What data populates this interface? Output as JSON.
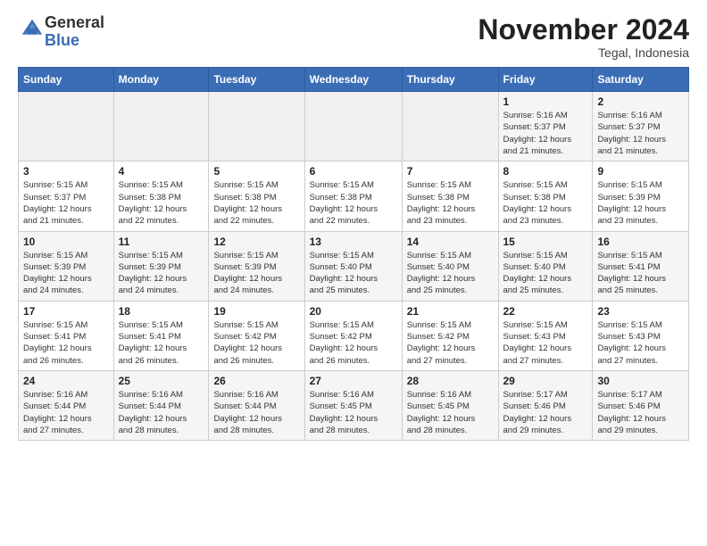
{
  "header": {
    "logo_general": "General",
    "logo_blue": "Blue",
    "month_year": "November 2024",
    "location": "Tegal, Indonesia"
  },
  "weekdays": [
    "Sunday",
    "Monday",
    "Tuesday",
    "Wednesday",
    "Thursday",
    "Friday",
    "Saturday"
  ],
  "weeks": [
    [
      {
        "day": "",
        "info": ""
      },
      {
        "day": "",
        "info": ""
      },
      {
        "day": "",
        "info": ""
      },
      {
        "day": "",
        "info": ""
      },
      {
        "day": "",
        "info": ""
      },
      {
        "day": "1",
        "info": "Sunrise: 5:16 AM\nSunset: 5:37 PM\nDaylight: 12 hours\nand 21 minutes."
      },
      {
        "day": "2",
        "info": "Sunrise: 5:16 AM\nSunset: 5:37 PM\nDaylight: 12 hours\nand 21 minutes."
      }
    ],
    [
      {
        "day": "3",
        "info": "Sunrise: 5:15 AM\nSunset: 5:37 PM\nDaylight: 12 hours\nand 21 minutes."
      },
      {
        "day": "4",
        "info": "Sunrise: 5:15 AM\nSunset: 5:38 PM\nDaylight: 12 hours\nand 22 minutes."
      },
      {
        "day": "5",
        "info": "Sunrise: 5:15 AM\nSunset: 5:38 PM\nDaylight: 12 hours\nand 22 minutes."
      },
      {
        "day": "6",
        "info": "Sunrise: 5:15 AM\nSunset: 5:38 PM\nDaylight: 12 hours\nand 22 minutes."
      },
      {
        "day": "7",
        "info": "Sunrise: 5:15 AM\nSunset: 5:38 PM\nDaylight: 12 hours\nand 23 minutes."
      },
      {
        "day": "8",
        "info": "Sunrise: 5:15 AM\nSunset: 5:38 PM\nDaylight: 12 hours\nand 23 minutes."
      },
      {
        "day": "9",
        "info": "Sunrise: 5:15 AM\nSunset: 5:39 PM\nDaylight: 12 hours\nand 23 minutes."
      }
    ],
    [
      {
        "day": "10",
        "info": "Sunrise: 5:15 AM\nSunset: 5:39 PM\nDaylight: 12 hours\nand 24 minutes."
      },
      {
        "day": "11",
        "info": "Sunrise: 5:15 AM\nSunset: 5:39 PM\nDaylight: 12 hours\nand 24 minutes."
      },
      {
        "day": "12",
        "info": "Sunrise: 5:15 AM\nSunset: 5:39 PM\nDaylight: 12 hours\nand 24 minutes."
      },
      {
        "day": "13",
        "info": "Sunrise: 5:15 AM\nSunset: 5:40 PM\nDaylight: 12 hours\nand 25 minutes."
      },
      {
        "day": "14",
        "info": "Sunrise: 5:15 AM\nSunset: 5:40 PM\nDaylight: 12 hours\nand 25 minutes."
      },
      {
        "day": "15",
        "info": "Sunrise: 5:15 AM\nSunset: 5:40 PM\nDaylight: 12 hours\nand 25 minutes."
      },
      {
        "day": "16",
        "info": "Sunrise: 5:15 AM\nSunset: 5:41 PM\nDaylight: 12 hours\nand 25 minutes."
      }
    ],
    [
      {
        "day": "17",
        "info": "Sunrise: 5:15 AM\nSunset: 5:41 PM\nDaylight: 12 hours\nand 26 minutes."
      },
      {
        "day": "18",
        "info": "Sunrise: 5:15 AM\nSunset: 5:41 PM\nDaylight: 12 hours\nand 26 minutes."
      },
      {
        "day": "19",
        "info": "Sunrise: 5:15 AM\nSunset: 5:42 PM\nDaylight: 12 hours\nand 26 minutes."
      },
      {
        "day": "20",
        "info": "Sunrise: 5:15 AM\nSunset: 5:42 PM\nDaylight: 12 hours\nand 26 minutes."
      },
      {
        "day": "21",
        "info": "Sunrise: 5:15 AM\nSunset: 5:42 PM\nDaylight: 12 hours\nand 27 minutes."
      },
      {
        "day": "22",
        "info": "Sunrise: 5:15 AM\nSunset: 5:43 PM\nDaylight: 12 hours\nand 27 minutes."
      },
      {
        "day": "23",
        "info": "Sunrise: 5:15 AM\nSunset: 5:43 PM\nDaylight: 12 hours\nand 27 minutes."
      }
    ],
    [
      {
        "day": "24",
        "info": "Sunrise: 5:16 AM\nSunset: 5:44 PM\nDaylight: 12 hours\nand 27 minutes."
      },
      {
        "day": "25",
        "info": "Sunrise: 5:16 AM\nSunset: 5:44 PM\nDaylight: 12 hours\nand 28 minutes."
      },
      {
        "day": "26",
        "info": "Sunrise: 5:16 AM\nSunset: 5:44 PM\nDaylight: 12 hours\nand 28 minutes."
      },
      {
        "day": "27",
        "info": "Sunrise: 5:16 AM\nSunset: 5:45 PM\nDaylight: 12 hours\nand 28 minutes."
      },
      {
        "day": "28",
        "info": "Sunrise: 5:16 AM\nSunset: 5:45 PM\nDaylight: 12 hours\nand 28 minutes."
      },
      {
        "day": "29",
        "info": "Sunrise: 5:17 AM\nSunset: 5:46 PM\nDaylight: 12 hours\nand 29 minutes."
      },
      {
        "day": "30",
        "info": "Sunrise: 5:17 AM\nSunset: 5:46 PM\nDaylight: 12 hours\nand 29 minutes."
      }
    ]
  ]
}
